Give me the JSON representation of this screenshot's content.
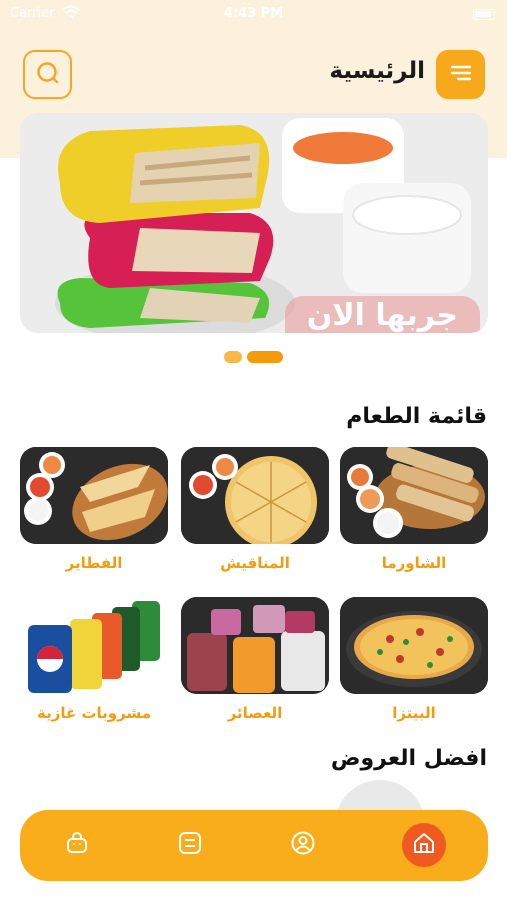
{
  "status_bar": {
    "carrier": "Carrier",
    "time": "4:43 PM"
  },
  "header": {
    "title": "الرئيسية",
    "menu_icon": "menu-icon",
    "search_icon": "search-icon"
  },
  "banner": {
    "cta": "جربها الان",
    "active_slide": 2,
    "slide_count": 2
  },
  "menu_section": {
    "title": "قائمة الطعام",
    "items": [
      {
        "label": "الشاورما"
      },
      {
        "label": "المناقيش"
      },
      {
        "label": "الفطاير"
      },
      {
        "label": "البيتزا"
      },
      {
        "label": "العصائر"
      },
      {
        "label": "مشروبات غازية"
      }
    ]
  },
  "offers_section": {
    "title": "افضل العروض"
  },
  "bottom_nav": {
    "items": [
      "home-icon",
      "profile-icon",
      "list-icon",
      "bag-icon"
    ],
    "active": "home-icon"
  },
  "colors": {
    "accent": "#f7a81b",
    "active_nav": "#f05a22",
    "label": "#f39c12",
    "header_bg": "#fbf1dd"
  }
}
